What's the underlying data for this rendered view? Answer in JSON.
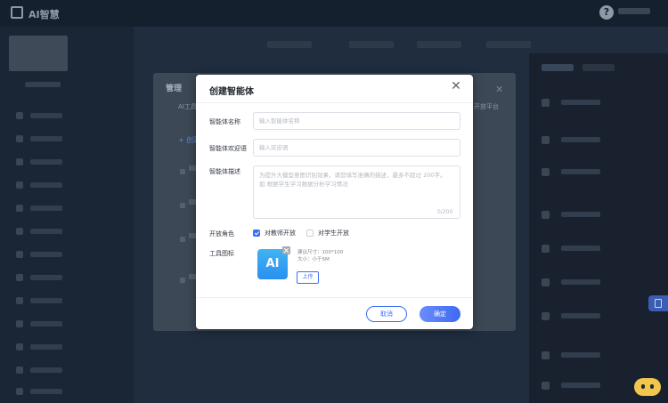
{
  "app": {
    "title": "AI智慧"
  },
  "header": {
    "help_icon": "question-circle-icon"
  },
  "manage": {
    "title": "管理",
    "subtitle": "AI工具",
    "add_label": "+ 创建",
    "right_label": "开放平台"
  },
  "dialog": {
    "title": "创建智能体",
    "close_icon": "close-icon",
    "name": {
      "label": "智能体名称",
      "placeholder": "输入智能体名称",
      "value": ""
    },
    "welcome": {
      "label": "智能体欢迎语",
      "placeholder": "输入欢迎语",
      "value": ""
    },
    "description": {
      "label": "智能体描述",
      "placeholder": "为提升大模型意图识别效果，请您填写准确的描述，最多不超过 200字。\n如:根据学生学习数据分析学习情况",
      "value": "",
      "counter": "0/200"
    },
    "roles": {
      "label": "开放角色",
      "options": [
        {
          "label": "对教师开放",
          "checked": true
        },
        {
          "label": "对学生开放",
          "checked": false
        }
      ]
    },
    "tool_icon": {
      "label": "工具图标",
      "icon_text": "AI",
      "size_hint": "建议尺寸：100*100",
      "file_hint": "大小：小于5M",
      "upload_label": "上传"
    },
    "cancel_label": "取消",
    "confirm_label": "确定"
  },
  "colors": {
    "primary": "#3b6ff3",
    "ai_icon": "#2b8ff0",
    "overlay": "#1f2d3f"
  }
}
